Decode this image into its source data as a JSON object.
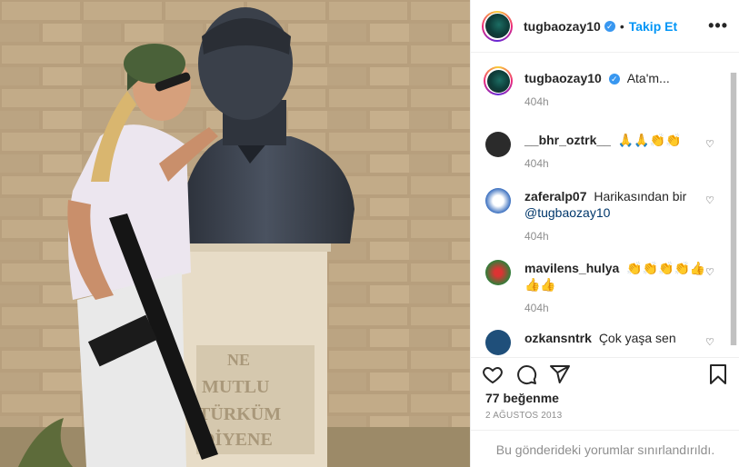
{
  "post": {
    "username": "tugbaozay10",
    "verified_mark": "✓",
    "separator": "•",
    "follow_label": "Takip Et",
    "more_label": "•••",
    "photo_inscription": [
      "NE",
      "MUTLU",
      "TÜRKÜM",
      "DİYENE"
    ]
  },
  "comments": [
    {
      "user": "tugbaozay10",
      "verified": true,
      "text": "Ata'm...",
      "time": "404h",
      "avatar_color": "#0e3e3a"
    },
    {
      "user": "__bhr_oztrk__",
      "verified": false,
      "text": "🙏🙏👏👏",
      "time": "404h",
      "avatar_color": "#2b2b2b"
    },
    {
      "user": "zaferalp07",
      "verified": false,
      "text": "Harikasından bir",
      "mention": "@tugbaozay10",
      "time": "404h",
      "avatar_color": "#3a6fbf"
    },
    {
      "user": "mavilens_hulya",
      "verified": false,
      "text": "👏👏👏👏👍",
      "text2": "👍👍",
      "time": "404h",
      "avatar_color": "#2f7f3a"
    },
    {
      "user": "ozkansntrk",
      "verified": false,
      "text": "Çok yaşa sen",
      "time": "",
      "avatar_color": "#1f4f7a"
    }
  ],
  "footer": {
    "likes": "77 beğenme",
    "date": "2 AĞUSTOS 2013",
    "limited_text": "Bu gönderideki yorumlar sınırlandırıldı."
  },
  "icons": {
    "like": "heart-icon",
    "comment": "comment-icon",
    "share": "share-icon",
    "save": "bookmark-icon",
    "comment_like": "small-heart-icon"
  },
  "colors": {
    "accent": "#0095f6",
    "verified": "#3897f0",
    "muted": "#8e8e8e"
  }
}
